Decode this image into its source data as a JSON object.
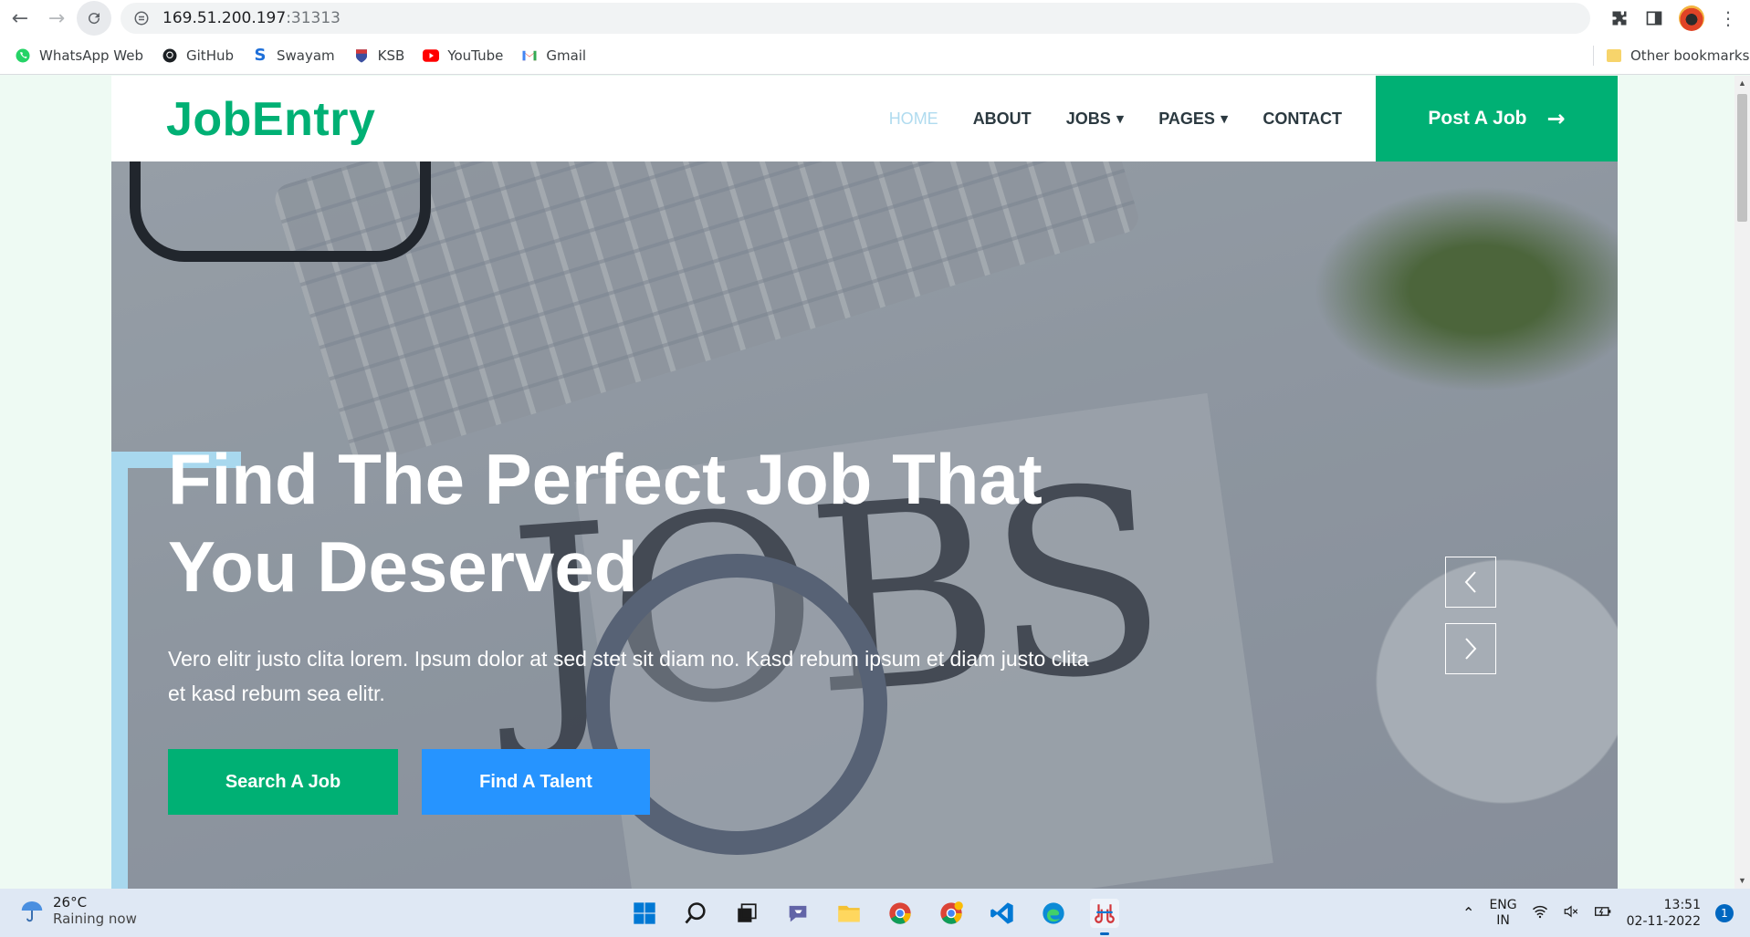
{
  "browser": {
    "url_host": "169.51.200.197",
    "url_port": ":31313",
    "bookmarks": [
      {
        "label": "WhatsApp Web",
        "icon": "whatsapp-icon"
      },
      {
        "label": "GitHub",
        "icon": "github-icon"
      },
      {
        "label": "Swayam",
        "icon": "swayam-icon"
      },
      {
        "label": "KSB",
        "icon": "ksb-icon"
      },
      {
        "label": "YouTube",
        "icon": "youtube-icon"
      },
      {
        "label": "Gmail",
        "icon": "gmail-icon"
      }
    ],
    "other_bookmarks": "Other bookmarks"
  },
  "site": {
    "brand": "JobEntry",
    "menu": [
      {
        "label": "HOME",
        "active": true
      },
      {
        "label": "ABOUT"
      },
      {
        "label": "JOBS",
        "dropdown": true
      },
      {
        "label": "PAGES",
        "dropdown": true
      },
      {
        "label": "CONTACT"
      }
    ],
    "post_job": "Post A Job",
    "hero": {
      "title_line1": "Find The Perfect Job That",
      "title_line2": "You Deserved",
      "text": "Vero elitr justo clita lorem. Ipsum dolor at sed stet sit diam no. Kasd rebum ipsum et diam justo clita et kasd rebum sea elitr.",
      "btn_search": "Search A Job",
      "btn_talent": "Find A Talent",
      "bg_word": "JOBS"
    },
    "colors": {
      "primary": "#00b074",
      "secondary": "#2694ff",
      "accent": "#a8d8ee"
    }
  },
  "taskbar": {
    "temp": "26°C",
    "condition": "Raining now",
    "lang_line1": "ENG",
    "lang_line2": "IN",
    "time": "13:51",
    "date": "02-11-2022",
    "notifications": "1"
  }
}
